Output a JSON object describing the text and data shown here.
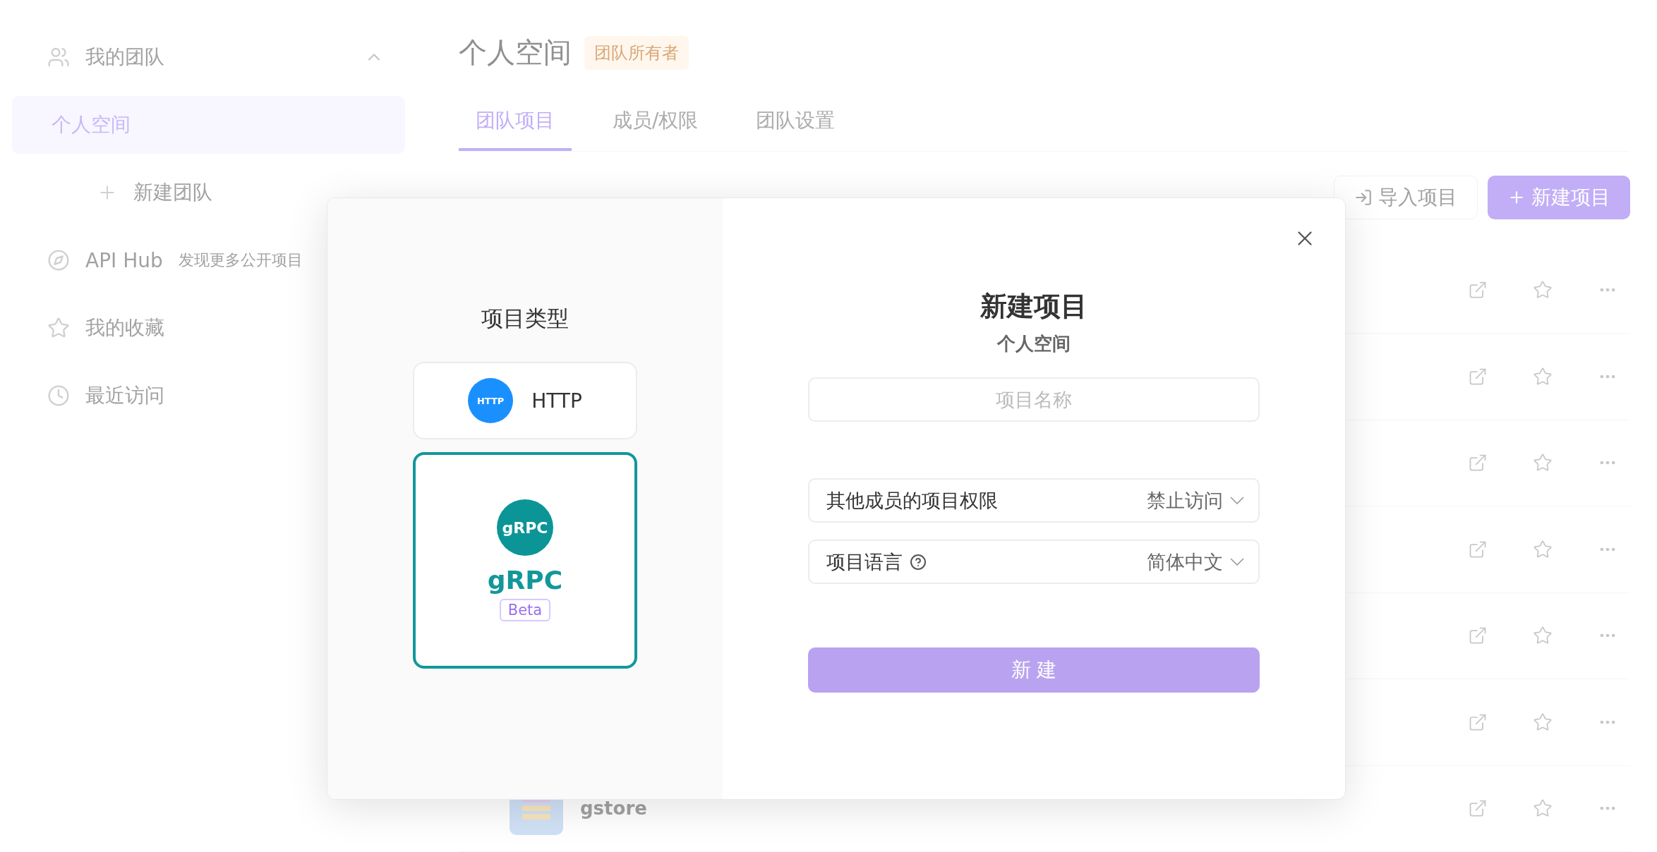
{
  "sidebar": {
    "items": [
      {
        "kind": "group",
        "label": "我的团队",
        "expanded": true,
        "children": [
          {
            "kind": "space",
            "label": "个人空间",
            "selected": true
          },
          {
            "kind": "action",
            "label": "新建团队",
            "selected": false
          }
        ]
      },
      {
        "kind": "hub",
        "label": "API Hub",
        "hint": "发现更多公开项目"
      },
      {
        "kind": "favorites",
        "label": "我的收藏"
      },
      {
        "kind": "recent",
        "label": "最近访问"
      }
    ]
  },
  "header": {
    "title": "个人空间",
    "badge": "团队所有者"
  },
  "tabs": [
    {
      "label": "团队项目",
      "selected": true
    },
    {
      "label": "成员/权限",
      "selected": false
    },
    {
      "label": "团队设置",
      "selected": false
    }
  ],
  "toolbar": {
    "import_button": "导入项目",
    "new_button": "新建项目"
  },
  "projects": [
    {
      "favorite": false
    },
    {
      "favorite": false
    },
    {
      "favorite": false
    },
    {
      "favorite": false
    },
    {
      "favorite": false
    },
    {
      "favorite": false
    },
    {
      "name": "gstore",
      "favorite": false
    }
  ],
  "dialog": {
    "types_title": "项目类型",
    "types": [
      {
        "kind": "http",
        "logo_text": "HTTP",
        "label": "HTTP",
        "selected": false
      },
      {
        "kind": "grpc",
        "logo_text": "gRPC",
        "label": "gRPC",
        "badge": "Beta",
        "selected": true
      }
    ],
    "title": "新建项目",
    "subtitle": "个人空间",
    "name_field": {
      "placeholder": "项目名称"
    },
    "selects": [
      {
        "label": "其他成员的项目权限",
        "help": false,
        "value": "禁止访问"
      },
      {
        "label": "项目语言",
        "help": true,
        "value": "简体中文"
      }
    ],
    "submit": "新 建"
  }
}
